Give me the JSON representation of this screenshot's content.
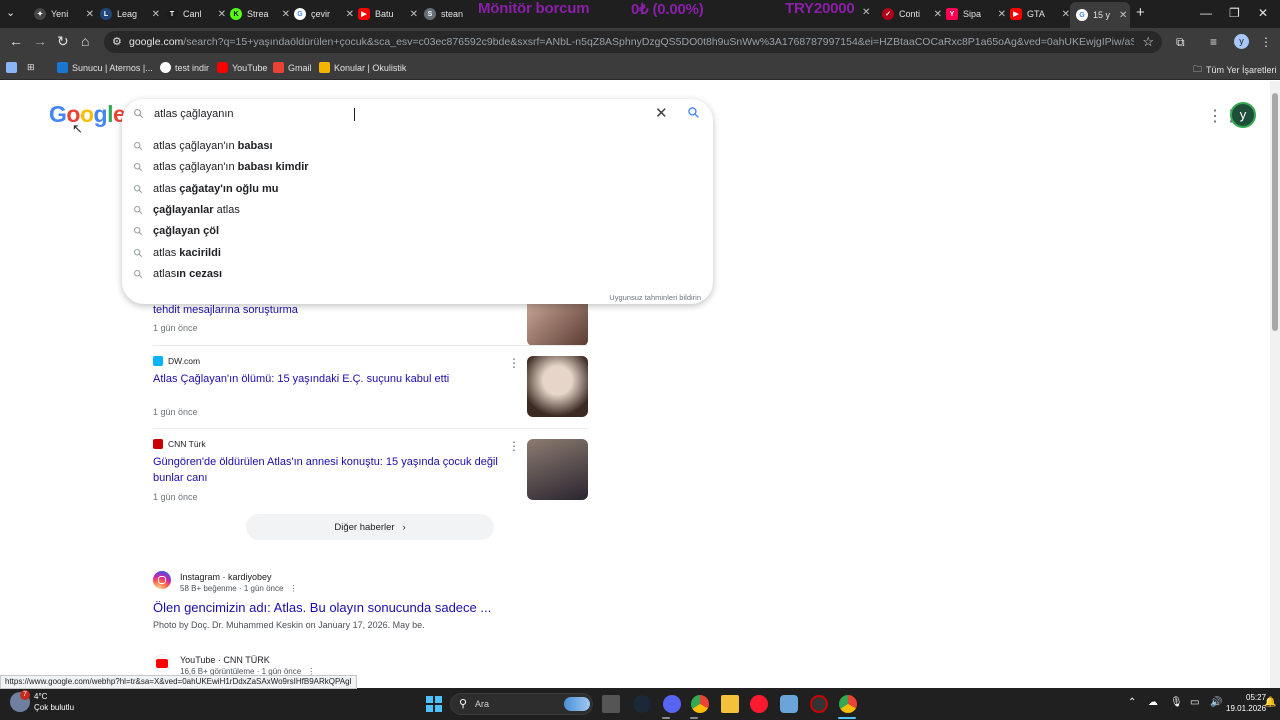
{
  "tabs": [
    {
      "label": "Yeni",
      "icon": "chatgpt-icon",
      "color": "#2b2b2b"
    },
    {
      "label": "Leag",
      "icon": "league-icon",
      "color": "#20467a"
    },
    {
      "label": "Canl",
      "icon": "canli-icon",
      "color": "#1c1c1c"
    },
    {
      "label": "Strea",
      "icon": "stream-icon",
      "color": "#53fc18"
    },
    {
      "label": "çevir",
      "icon": "google-translate-icon",
      "color": "#4285f4"
    },
    {
      "label": "Batu",
      "icon": "youtube-icon",
      "color": "#ff0000"
    },
    {
      "label": "stean",
      "icon": "steam-icon",
      "color": "#66707a"
    },
    {
      "label": "Conti",
      "icon": "conti-icon",
      "color": "#b3001b"
    },
    {
      "label": "Sipa",
      "icon": "yemeksepeti-icon",
      "color": "#fa0050"
    },
    {
      "label": "GTA",
      "icon": "youtube-icon",
      "color": "#ff0000"
    },
    {
      "label": "15 y",
      "icon": "google-icon",
      "color": "#4285f4"
    }
  ],
  "ticker": {
    "title": "Mönitör borcum",
    "value": "0₺ (0.00%)",
    "target": "TRY20000"
  },
  "address_bar": {
    "host": "google.com",
    "path": "/search?q=15+yaşındaöldürülen+çocuk&sca_esv=c03ec876592c9bde&sxsrf=ANbL-n5qZ8ASphnyDzgQS5DO0t8h9uSnWw%3A1768787997154&ei=HZBtaaCOCaRxc8P1a65oAg&ved=0ahUKEwjgIPiw/aSAxWjSPEDHVVXDoQQ4dU..."
  },
  "profile_initial": "y",
  "bookmarks": [
    {
      "label": "Sunucu | Aternos |...",
      "icon": "aternos-icon",
      "color": "#1976d2"
    },
    {
      "label": "test indir",
      "icon": "github-icon",
      "color": "#ffffff"
    },
    {
      "label": "YouTube",
      "icon": "youtube-icon",
      "color": "#ff0000"
    },
    {
      "label": "Gmail",
      "icon": "gmail-icon",
      "color": "#ea4335"
    },
    {
      "label": "Konular | Okulistik",
      "icon": "okulistik-icon",
      "color": "#f4b400"
    }
  ],
  "all_bookmarks": "Tüm Yer İşaretleri",
  "search": {
    "query": "atlas çağlayanın",
    "suggestions": [
      {
        "plain": "atlas çağlayan'ın ",
        "bold": "babası",
        "tail": ""
      },
      {
        "plain": "atlas çağlayan'ın ",
        "bold": "babası kimdir",
        "tail": ""
      },
      {
        "plain": "atlas ",
        "bold": "çağatay'ın oğlu mu",
        "tail": ""
      },
      {
        "plain": "",
        "bold": "çağlayanlar",
        "tail": " atlas"
      },
      {
        "plain": "",
        "bold": "çağlayan çöl",
        "tail": ""
      },
      {
        "plain": "atlas ",
        "bold": "kacirildi",
        "tail": ""
      },
      {
        "plain": "atlas",
        "bold": "ın cezası",
        "tail": ""
      }
    ],
    "report": "Uygunsuz tahminleri bildirin"
  },
  "news": [
    {
      "source": "",
      "title": "tehdit mesajlarına soruşturma",
      "time": "1 gün önce",
      "src_color": "#ffffff",
      "thumb": [
        "#d9b8a8",
        "#5a3a30"
      ]
    },
    {
      "source": "DW.com",
      "title": "Atlas Çağlayan'ın ölümü: 15 yaşındaki E.Ç. suçunu kabul etti",
      "time": "1 gün önce",
      "src_color": "#05b2fc",
      "thumb": [
        "#e6d5c8",
        "#3b2a22"
      ]
    },
    {
      "source": "CNN Türk",
      "title": "Güngören'de öldürülen Atlas'ın annesi konuştu: 15 yaşında çocuk değil bunlar canı",
      "time": "1 gün önce",
      "src_color": "#cc0000",
      "thumb": [
        "#8c7b70",
        "#2a2530"
      ]
    }
  ],
  "more_news": "Diğer haberler",
  "web_results": [
    {
      "site": "Instagram · kardiyobey",
      "meta": "58 B+ beğenme · 1 gün önce",
      "title": "Ölen gencimizin adı: Atlas. Bu olayın sonucunda sadece ...",
      "snippet": "Photo by Doç. Dr. Muhammed Keskin on January 17, 2026. May be.",
      "icon": "instagram-icon",
      "color": "#d62976"
    },
    {
      "site": "YouTube · CNN TÜRK",
      "meta": "16,6 B+ görüntüleme · 1 gün önce",
      "title": "",
      "snippet": "",
      "icon": "youtube-icon",
      "color": "#ff0000"
    }
  ],
  "status_url": "https://www.google.com/webhp?hl=tr&sa=X&ved=0ahUKEwiH1rDdxZaSAxWo9rsIHfB9ARkQPAgI",
  "taskbar": {
    "temperature": "4°C",
    "weather": "Çok bulutlu",
    "weather_badge": "7",
    "search_placeholder": "Ara",
    "time": "05:27",
    "date": "19.01.2026"
  }
}
